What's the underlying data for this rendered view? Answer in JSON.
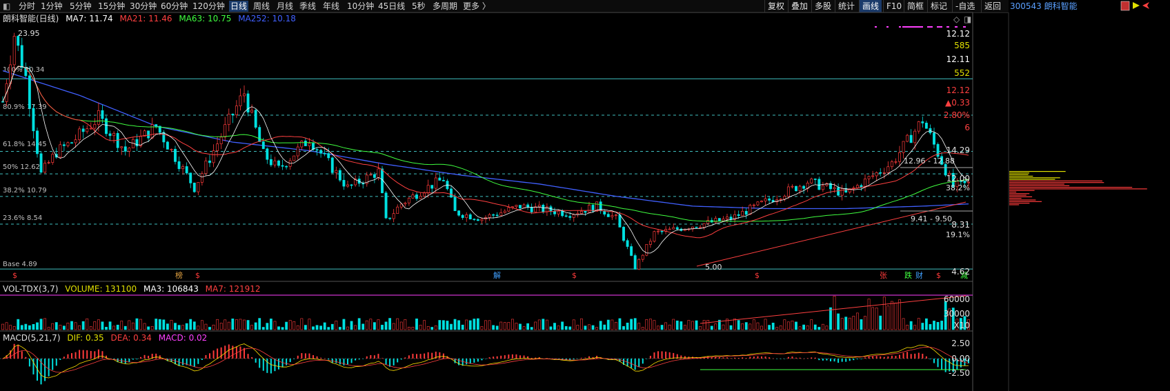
{
  "toolbar": {
    "periods": [
      "分时",
      "1分钟",
      "5分钟",
      "15分钟",
      "30分钟",
      "60分钟",
      "120分钟",
      "日线",
      "周线",
      "月线",
      "季线",
      "年线",
      "10分钟",
      "45日线",
      "5秒",
      "多周期",
      "更多 〉"
    ],
    "active_period": "日线",
    "right_buttons": [
      "复权",
      "叠加",
      "多股",
      "统计",
      "画线",
      "F10",
      "简框",
      "标记",
      "-自选",
      "返回"
    ]
  },
  "stock_header": "300543 朗科智能",
  "main_legend": {
    "name": "朗科智能(日线)",
    "ma7": "MA7: 11.74",
    "ma21": "MA21: 11.46",
    "ma63": "MA63: 10.75",
    "ma252": "MA252: 10.18"
  },
  "vol_legend": {
    "name": "VOL-TDX(3,7)",
    "volume": "VOLUME: 131100",
    "ma3": "MA3: 106843",
    "ma7": "MA7: 121912"
  },
  "macd_legend": {
    "name": "MACD(5,21,7)",
    "dif": "DIF: 0.35",
    "dea": "DEA: 0.34",
    "macd": "MACD: 0.02"
  },
  "right_axis": {
    "main": [
      "12.12",
      "585",
      "12.11",
      "552",
      "12.12",
      "▲0.33",
      "2.80%",
      "6",
      "14.29",
      "12.00",
      "38.2%",
      "8.31",
      "19.1%",
      "4.62"
    ],
    "vol": [
      "60000",
      "30000",
      "X10"
    ],
    "macd": [
      "2.50",
      "0.00",
      "-2.50"
    ]
  },
  "fib_labels": [
    "100% 20.34",
    "80.9% 17.39",
    "61.8% 14.45",
    "50% 12.62",
    "38.2% 10.79",
    "23.6% 8.54",
    "Base 4.89"
  ],
  "annotations": {
    "high": "23.95",
    "low": "5.00",
    "range_top": "12.96 - 12.88",
    "range_bottom": "9.41 - 9.50"
  },
  "event_markers": [
    "$",
    "榜",
    "$",
    "解",
    "$",
    "$",
    "张",
    "跌",
    "财",
    "$",
    "减"
  ],
  "colors": {
    "up": "#ff3b3b",
    "down": "#00e0e0",
    "ma7": "#ffffff",
    "ma21": "#ff4040",
    "ma63": "#40ff40",
    "ma252": "#4060ff",
    "fib": "#40c0c0",
    "accent": "#e0e000",
    "magenta": "#ff40ff"
  },
  "chart_data": {
    "type": "candlestick",
    "title": "朗科智能(日线)",
    "ylim": [
      4.62,
      24.5
    ],
    "price_path": {
      "x": [
        0,
        3,
        6,
        10,
        14,
        18,
        25,
        32,
        40,
        50,
        60,
        63,
        68,
        72,
        80,
        90,
        98,
        100,
        104,
        110,
        115,
        118,
        125,
        135,
        148,
        155,
        160,
        165,
        170,
        180,
        190,
        200,
        210,
        220,
        232,
        240,
        248,
        252
      ],
      "y": [
        18.5,
        23.95,
        20.5,
        12.6,
        14.4,
        15.2,
        17.2,
        14.5,
        16.5,
        11.5,
        17.5,
        19.2,
        14.2,
        13.0,
        15.5,
        11.5,
        12.8,
        8.8,
        10.2,
        11.4,
        12.2,
        9.5,
        9.0,
        10.0,
        9.4,
        10.0,
        9.0,
        5.0,
        7.8,
        8.4,
        9.0,
        10.5,
        12.0,
        11.0,
        13.5,
        17.0,
        11.6,
        11.8
      ]
    },
    "ma252_path": {
      "x": [
        0,
        20,
        40,
        60,
        80,
        100,
        120,
        140,
        160,
        180,
        200,
        220,
        240,
        252
      ],
      "y": [
        21.0,
        19.0,
        16.5,
        15.2,
        14.5,
        13.4,
        12.5,
        11.8,
        10.8,
        10.0,
        9.8,
        9.8,
        10.0,
        10.18
      ]
    },
    "fib_levels": [
      {
        "label": "100%",
        "value": 20.34
      },
      {
        "label": "80.9%",
        "value": 17.39
      },
      {
        "label": "61.8%",
        "value": 14.45
      },
      {
        "label": "50%",
        "value": 12.62
      },
      {
        "label": "38.2%",
        "value": 10.79
      },
      {
        "label": "23.6%",
        "value": 8.54
      },
      {
        "label": "Base",
        "value": 4.89
      }
    ],
    "volume_ylim": [
      0,
      70000
    ],
    "macd_ylim": [
      -4,
      4
    ]
  }
}
